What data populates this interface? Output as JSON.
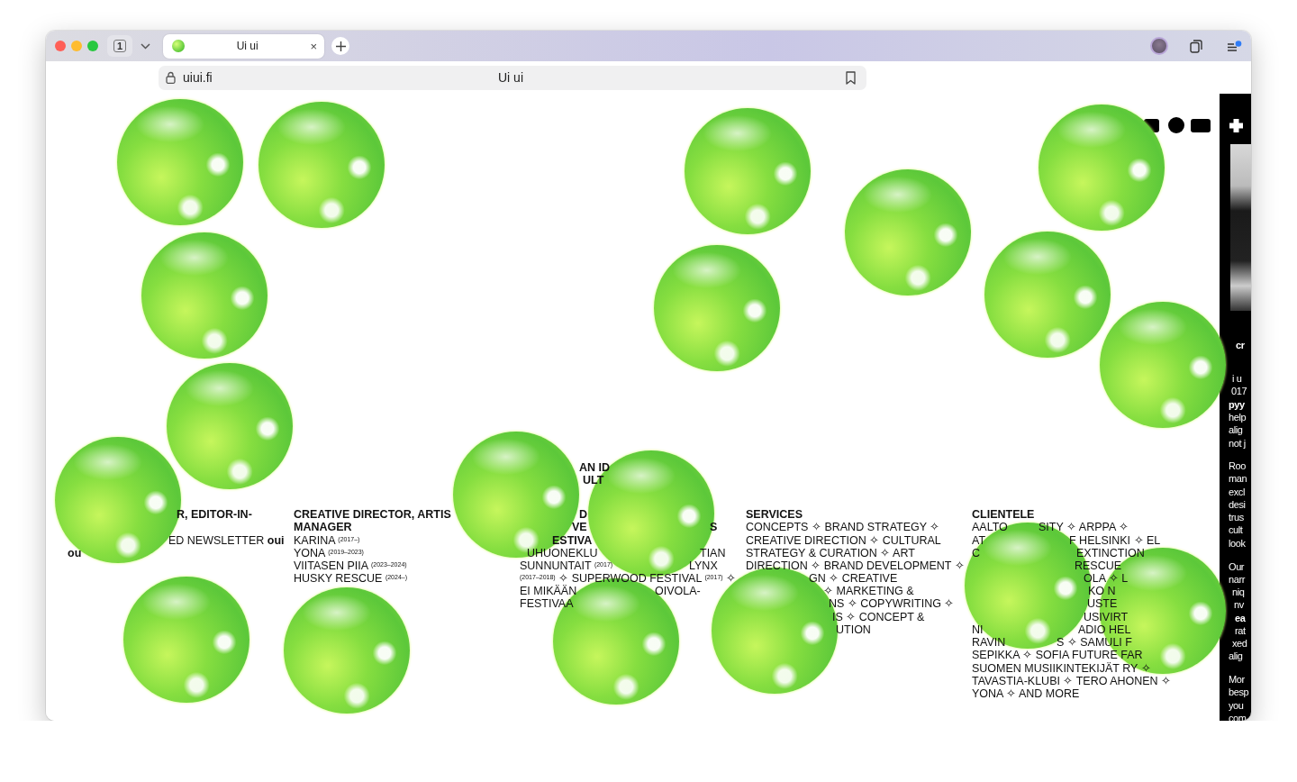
{
  "browser": {
    "tab_count": "1",
    "tabs": [
      {
        "title": "Ui ui",
        "close": "×",
        "selected": true
      }
    ],
    "address": {
      "domain": "uiui.fi",
      "page_title": "Ui ui"
    }
  },
  "columns": [
    {
      "heading": [
        "R, EDITOR-IN-"
      ],
      "body": [
        "ED NEWSLETTER **oui**",
        "**ou**"
      ]
    },
    {
      "heading": [
        "CREATIVE DIRECTOR, ARTIS",
        "MANAGER"
      ],
      "body": [
        "KARINA $^{(2017–)}$",
        "YONA $^{(2019–2023)}$",
        "VIITASEN PIIA $^{(2023–2024)}$",
        "HUSKY RESCUE $^{(2024–)}$"
      ]
    },
    {
      "intro": [
        "AN ID",
        "ULT"
      ],
      "heading": [
        "D",
        "VE",
        "S",
        "ESTIVA"
      ],
      "body": [
        "UHUONEKLU",
        "TIAN",
        "SUNNUNTAIT $^{(2017)}$",
        "LYNX",
        "$^{(2017–2018)}$ ✧ SUPERWOOD FESTIVAL $^{(2017)}$ ✧",
        "EI MIKÄÄN",
        "OIVOLA-",
        "FESTIVAA"
      ]
    },
    {
      "heading": [
        "SERVICES"
      ],
      "body": [
        "CONCEPTS ✧ BRAND STRATEGY ✧",
        "CREATIVE DIRECTION ✧ CULTURAL",
        "STRATEGY & CURATION ✧ ART",
        "DIRECTION ✧ BRAND DEVELOPMENT ✧",
        "GN ✧ CREATIVE",
        "✧ MARKETING &",
        "NS ✧ COPYWRITING ✧",
        "IS ✧ CONCEPT &",
        "UTION"
      ]
    },
    {
      "heading": [
        "CLIENTELE"
      ],
      "body": [
        "AALTO",
        "SITY ✧ ARPPA ✧",
        "AT",
        "F HELSINKI ✧ EL",
        "C",
        "EXTINCTION",
        "RESCUE",
        "OLA ✧ L",
        "KO N",
        "USTE",
        "USIVIRT",
        "NI",
        "ADIO HEL",
        "RAVIN",
        "S ✧ SAMULI F",
        "SEPIKKA ✧ SOFIA FUTURE FAR",
        "SUOMEN MUSIIKINTEKIJÄT RY ✧",
        "TAVASTIA-KLUBI ✧ TERO AHONEN ✧",
        "YONA ✧ AND MORE"
      ]
    }
  ],
  "side_panel": {
    "lines": [
      "**cr**",
      "i u",
      "017",
      "**pyy**",
      "help",
      "alig",
      "not j",
      "Roo",
      "man",
      "excl",
      "desi",
      "trus",
      "cult",
      "look",
      "Our",
      "narr",
      "niq",
      "nv",
      "**ea**",
      "rat",
      "xed",
      "alig",
      "Mor",
      "besp",
      "you",
      "com"
    ]
  }
}
